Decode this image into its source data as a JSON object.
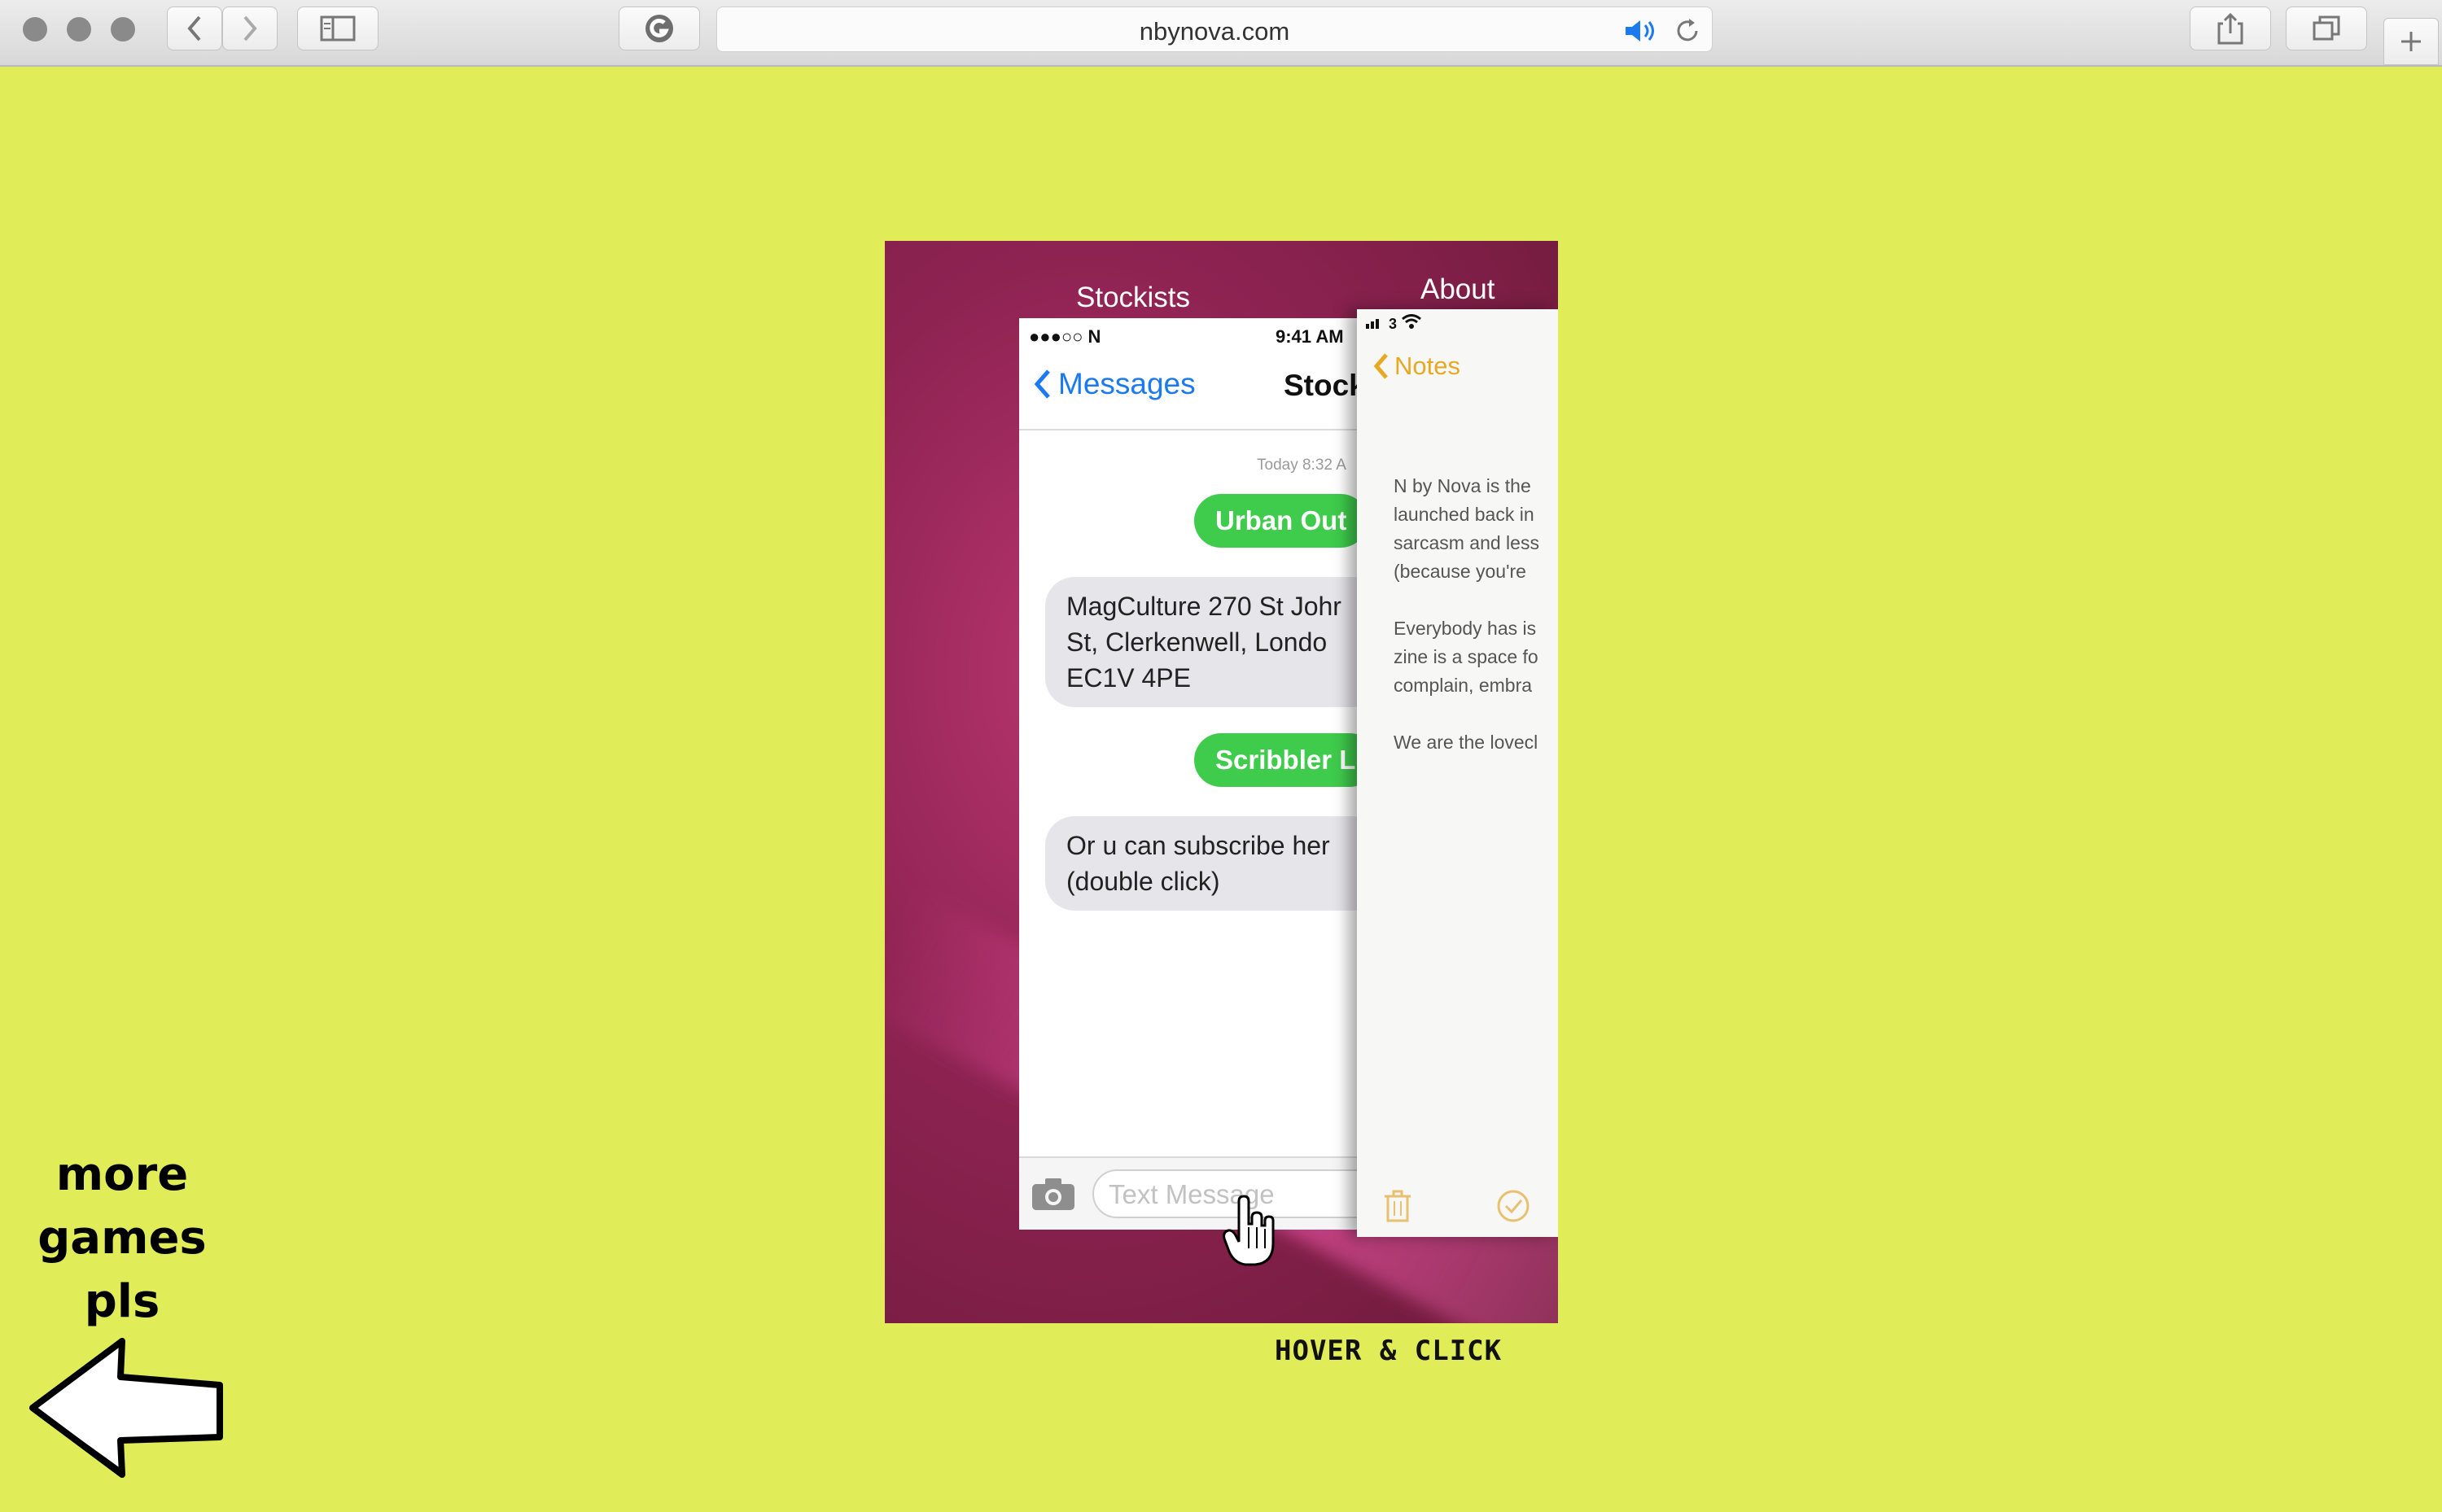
{
  "browser": {
    "url": "nbynova.com",
    "icons": [
      "back-icon",
      "forward-icon",
      "sidebar-icon",
      "reader-icon",
      "audio-icon",
      "reload-icon",
      "share-icon",
      "tabs-icon",
      "new-tab-icon"
    ]
  },
  "game": {
    "stockists_label": "Stockists",
    "about_label": "About",
    "messages": {
      "status_left": "●●●○○ N ",
      "time": "9:41 AM",
      "back_label": "Messages",
      "title": "Stock",
      "timestamp": "Today 8:32 A",
      "bubbles": [
        {
          "type": "sent",
          "text": "Urban Out"
        },
        {
          "type": "received",
          "text": "MagCulture 270 St Johr\nSt, Clerkenwell, Londo\nEC1V 4PE"
        },
        {
          "type": "sent",
          "text": "Scribbler L"
        },
        {
          "type": "received",
          "text": "Or u can subscribe her\n(double click)"
        }
      ],
      "input_placeholder": "Text Message"
    },
    "notes": {
      "status": "3",
      "back_label": "Notes",
      "body": "N by Nova is the\nlaunched back in\nsarcasm and less\n(because you're\n\nEverybody has is\nzine is a space fo\ncomplain, embra\n\nWe are the lovecl"
    }
  },
  "hint": "HOVER & CLICK",
  "more_games": {
    "line1": "more",
    "line2": "games",
    "line3": "pls"
  },
  "colors": {
    "background": "#e0ec58",
    "bubble_green": "#3fcb4c",
    "ios_blue": "#1c7af0",
    "notes_yellow": "#e8a824"
  }
}
